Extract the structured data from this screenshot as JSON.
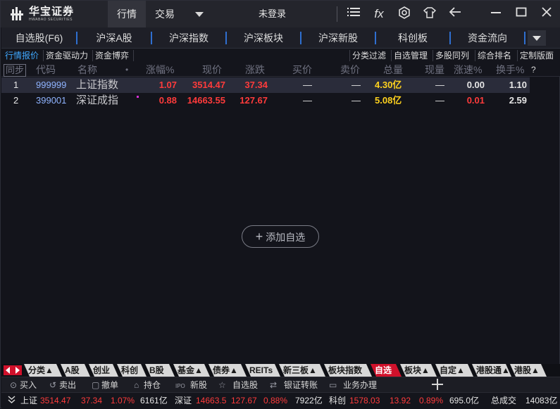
{
  "app": {
    "logo_cn": "华宝证券",
    "logo_en": "HWABAO SECURITIES",
    "tabs": [
      "行情",
      "交易"
    ],
    "login_status": "未登录",
    "toolbar_icons": [
      "menu-icon",
      "function-fx-icon",
      "settings-icon",
      "skin-icon",
      "back-icon",
      "minimize-icon",
      "maximize-icon",
      "close-icon"
    ],
    "fx_label": "fx"
  },
  "nav": {
    "tabs": [
      "自选股(F6)",
      "沪深A股",
      "沪深指数",
      "沪深板块",
      "沪深新股",
      "科创板",
      "资金流向"
    ]
  },
  "subbar": {
    "left": [
      "行情报价",
      "资金驱动力",
      "资金博弈"
    ],
    "right": [
      "分类过滤",
      "自选管理",
      "多股同列",
      "综合排名",
      "定制版面"
    ]
  },
  "table": {
    "sync_label": "同步",
    "headers": {
      "code": "代码",
      "name": "名称",
      "dot": "•",
      "change_pct": "涨幅%",
      "price": "现价",
      "change": "涨跌",
      "bid": "买价",
      "ask": "卖价",
      "volume": "总量",
      "cur_vol": "现量",
      "speed": "涨速%",
      "turnover": "换手%",
      "help": "?"
    },
    "rows": [
      {
        "idx": "1",
        "code": "999999",
        "name": "上证指数",
        "change_pct": "1.07",
        "price": "3514.47",
        "change": "37.34",
        "bid": "—",
        "ask": "—",
        "volume": "4.30亿",
        "cur_vol": "—",
        "speed": "0.00",
        "turnover": "1.10"
      },
      {
        "idx": "2",
        "code": "399001",
        "name": "深证成指",
        "change_pct": "0.88",
        "price": "14663.55",
        "change": "127.67",
        "bid": "—",
        "ask": "—",
        "volume": "5.08亿",
        "cur_vol": "—",
        "speed": "0.01",
        "turnover": "2.59"
      }
    ]
  },
  "add_watch": {
    "plus": "+",
    "label": "添加自选"
  },
  "categories": [
    "分类▲",
    "A股",
    "创业",
    "科创",
    "B股",
    "基金▲",
    "债券▲",
    "REITs",
    "新三板▲",
    "板块指数",
    "自选",
    "板块▲",
    "自定▲",
    "港股通▲",
    "港股▲"
  ],
  "trade": [
    {
      "icon": "buy-icon",
      "glyph": "⊙",
      "label": "买入"
    },
    {
      "icon": "sell-icon",
      "glyph": "↺",
      "label": "卖出"
    },
    {
      "icon": "cancel-order-icon",
      "glyph": "▢",
      "label": "撤单"
    },
    {
      "icon": "holdings-icon",
      "glyph": "⌂",
      "label": "持仓"
    },
    {
      "icon": "ipo-icon",
      "glyph": "IPO",
      "label": "新股"
    },
    {
      "icon": "star-icon",
      "glyph": "☆",
      "label": "自选股"
    },
    {
      "icon": "transfer-icon",
      "glyph": "⇄",
      "label": "银证转账"
    },
    {
      "icon": "briefcase-icon",
      "glyph": "▭",
      "label": "业务办理"
    }
  ],
  "status": {
    "sh_label": "上证",
    "sh_price": "3514.47",
    "sh_change": "37.34",
    "sh_pct": "1.07%",
    "sh_amount": "6161亿",
    "sz_label": "深证",
    "sz_price": "14663.5",
    "sz_change": "127.67",
    "sz_pct": "0.88%",
    "sz_amount": "7922亿",
    "kc_label": "科创",
    "kc_price": "1578.03",
    "kc_change": "13.92",
    "kc_pct": "0.89%",
    "kc_amount": "695.0亿",
    "total_label": "总成交",
    "total_value": "14083亿"
  },
  "colors": {
    "up": "#ff3b3b",
    "volume": "#ffd21e",
    "accent": "#3fa8ff",
    "active_tab": "#d0112b"
  }
}
